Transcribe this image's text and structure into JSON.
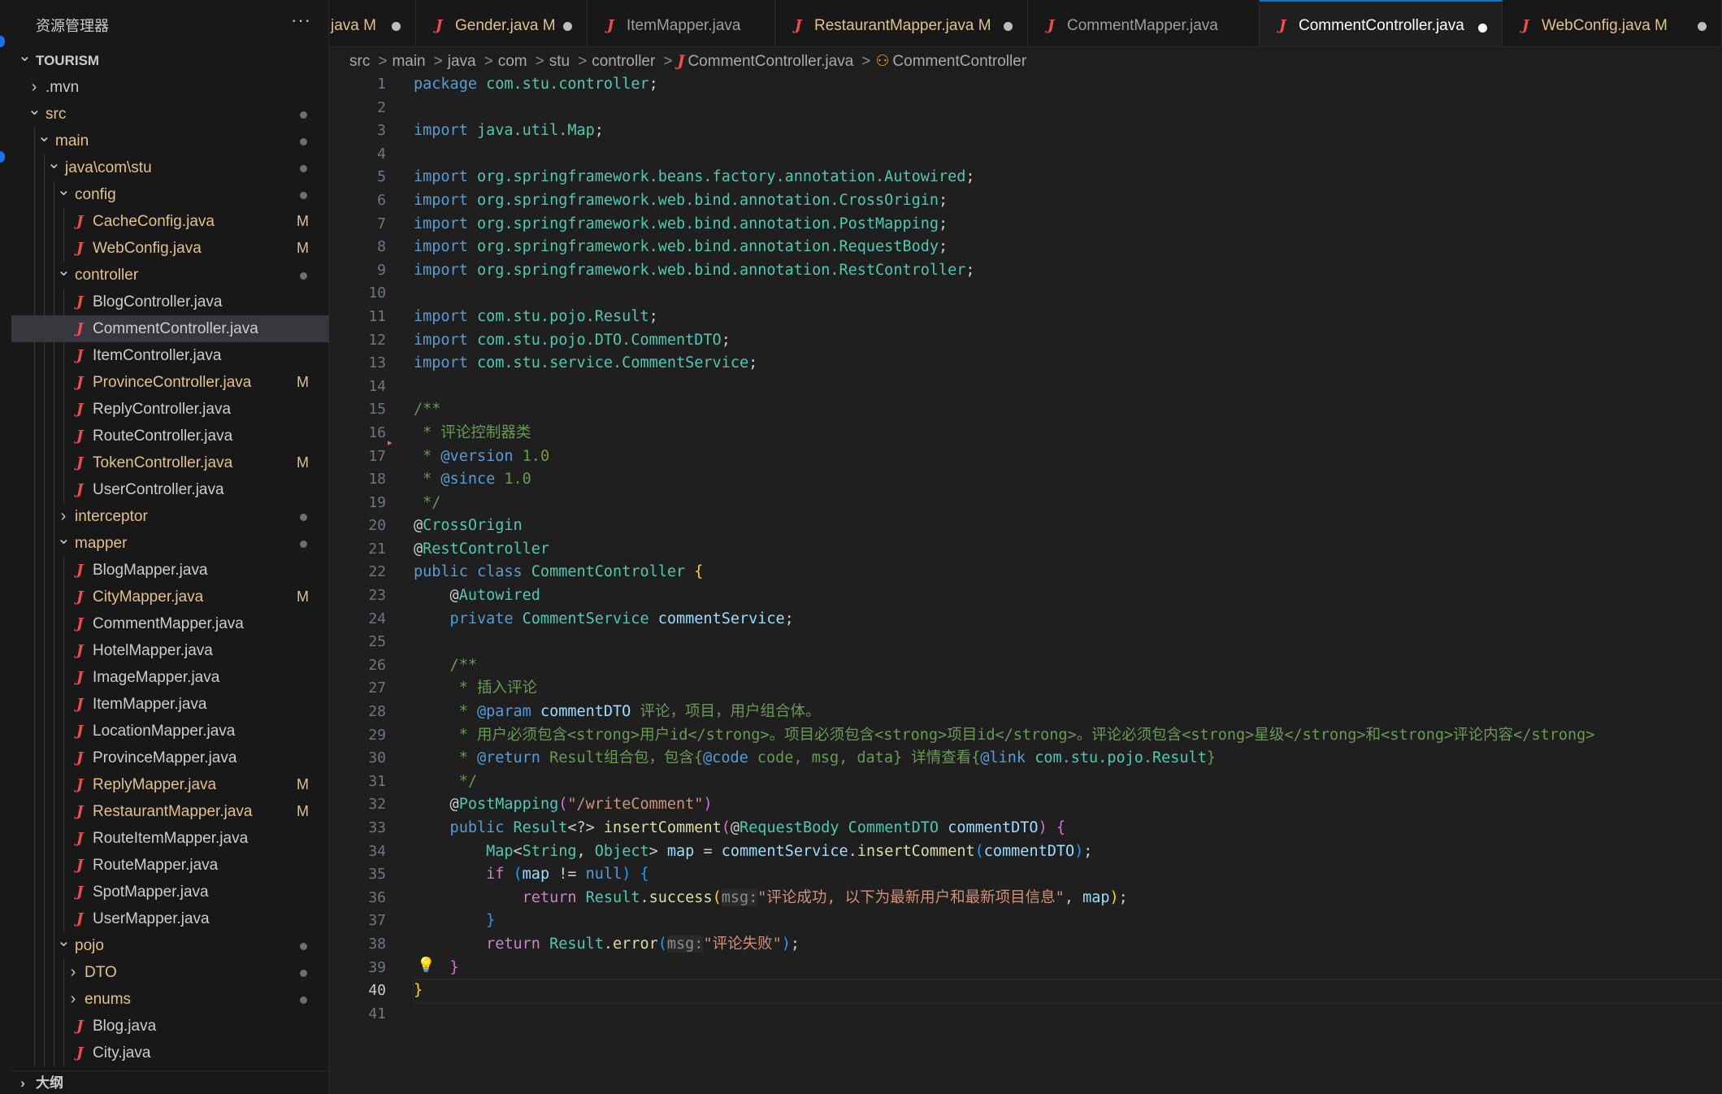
{
  "sidebar": {
    "title": "资源管理器",
    "more": "···",
    "outline_label": "大纲",
    "tree": [
      {
        "label": "TOURISM",
        "depth": 0,
        "kind": "root",
        "chevron": "open"
      },
      {
        "label": ".mvn",
        "depth": 1,
        "kind": "folder",
        "chevron": "closed"
      },
      {
        "label": "src",
        "depth": 1,
        "kind": "folder-mod",
        "chevron": "open",
        "dot": true
      },
      {
        "label": "main",
        "depth": 2,
        "kind": "folder-mod",
        "chevron": "open",
        "dot": true
      },
      {
        "label": "java\\com\\stu",
        "depth": 3,
        "kind": "folder-mod",
        "chevron": "open",
        "dot": true
      },
      {
        "label": "config",
        "depth": 4,
        "kind": "folder-mod",
        "chevron": "open",
        "dot": true
      },
      {
        "label": "CacheConfig.java",
        "depth": 5,
        "kind": "java-mod",
        "badge": "M"
      },
      {
        "label": "WebConfig.java",
        "depth": 5,
        "kind": "java-mod",
        "badge": "M"
      },
      {
        "label": "controller",
        "depth": 4,
        "kind": "folder-mod",
        "chevron": "open",
        "dot": true
      },
      {
        "label": "BlogController.java",
        "depth": 5,
        "kind": "java"
      },
      {
        "label": "CommentController.java",
        "depth": 5,
        "kind": "java",
        "selected": true
      },
      {
        "label": "ItemController.java",
        "depth": 5,
        "kind": "java"
      },
      {
        "label": "ProvinceController.java",
        "depth": 5,
        "kind": "java-mod",
        "badge": "M"
      },
      {
        "label": "ReplyController.java",
        "depth": 5,
        "kind": "java"
      },
      {
        "label": "RouteController.java",
        "depth": 5,
        "kind": "java"
      },
      {
        "label": "TokenController.java",
        "depth": 5,
        "kind": "java-mod",
        "badge": "M"
      },
      {
        "label": "UserController.java",
        "depth": 5,
        "kind": "java"
      },
      {
        "label": "interceptor",
        "depth": 4,
        "kind": "folder-mod",
        "chevron": "closed",
        "dot": true
      },
      {
        "label": "mapper",
        "depth": 4,
        "kind": "folder-mod",
        "chevron": "open",
        "dot": true
      },
      {
        "label": "BlogMapper.java",
        "depth": 5,
        "kind": "java"
      },
      {
        "label": "CityMapper.java",
        "depth": 5,
        "kind": "java-mod",
        "badge": "M"
      },
      {
        "label": "CommentMapper.java",
        "depth": 5,
        "kind": "java"
      },
      {
        "label": "HotelMapper.java",
        "depth": 5,
        "kind": "java"
      },
      {
        "label": "ImageMapper.java",
        "depth": 5,
        "kind": "java"
      },
      {
        "label": "ItemMapper.java",
        "depth": 5,
        "kind": "java"
      },
      {
        "label": "LocationMapper.java",
        "depth": 5,
        "kind": "java"
      },
      {
        "label": "ProvinceMapper.java",
        "depth": 5,
        "kind": "java"
      },
      {
        "label": "ReplyMapper.java",
        "depth": 5,
        "kind": "java-mod",
        "badge": "M"
      },
      {
        "label": "RestaurantMapper.java",
        "depth": 5,
        "kind": "java-mod",
        "badge": "M"
      },
      {
        "label": "RouteItemMapper.java",
        "depth": 5,
        "kind": "java"
      },
      {
        "label": "RouteMapper.java",
        "depth": 5,
        "kind": "java"
      },
      {
        "label": "SpotMapper.java",
        "depth": 5,
        "kind": "java"
      },
      {
        "label": "UserMapper.java",
        "depth": 5,
        "kind": "java"
      },
      {
        "label": "pojo",
        "depth": 4,
        "kind": "folder-mod",
        "chevron": "open",
        "dot": true
      },
      {
        "label": "DTO",
        "depth": 5,
        "kind": "folder-mod",
        "chevron": "closed",
        "dot": true
      },
      {
        "label": "enums",
        "depth": 5,
        "kind": "folder-mod",
        "chevron": "closed",
        "dot": true
      },
      {
        "label": "Blog.java",
        "depth": 5,
        "kind": "java"
      },
      {
        "label": "City.java",
        "depth": 5,
        "kind": "java"
      }
    ]
  },
  "tabs": [
    {
      "label": "java",
      "badge": "M",
      "modified": true,
      "dirty_dot": true,
      "icon": false
    },
    {
      "label": "Gender.java",
      "badge": "M",
      "modified": true,
      "dirty_dot": true,
      "icon": true
    },
    {
      "label": "ItemMapper.java",
      "modified": false,
      "icon": true
    },
    {
      "label": "RestaurantMapper.java",
      "badge": "M",
      "modified": true,
      "dirty_dot": true,
      "icon": true
    },
    {
      "label": "CommentMapper.java",
      "modified": false,
      "icon": true
    },
    {
      "label": "CommentController.java",
      "modified": false,
      "dirty_dot": true,
      "icon": true,
      "active": true
    },
    {
      "label": "WebConfig.java",
      "badge": "M",
      "modified": true,
      "dirty_dot": true,
      "icon": true
    }
  ],
  "breadcrumb": {
    "parts": [
      "src",
      "main",
      "java",
      "com",
      "stu",
      "controller"
    ],
    "file": "CommentController.java",
    "symbol": "CommentController",
    "separator": ">",
    "java_glyph": "J",
    "class_glyph": "⚇"
  },
  "editor": {
    "current_line": 40,
    "lines": [
      [
        [
          "kw",
          "package "
        ],
        [
          "pkg",
          "com.stu.controller"
        ],
        [
          "plain",
          ";"
        ]
      ],
      [],
      [
        [
          "kw",
          "import "
        ],
        [
          "pkg",
          "java.util.Map"
        ],
        [
          "plain",
          ";"
        ]
      ],
      [],
      [
        [
          "kw",
          "import "
        ],
        [
          "pkg",
          "org.springframework.beans.factory.annotation.Autowired"
        ],
        [
          "plain",
          ";"
        ]
      ],
      [
        [
          "kw",
          "import "
        ],
        [
          "pkg",
          "org.springframework.web.bind.annotation.CrossOrigin"
        ],
        [
          "plain",
          ";"
        ]
      ],
      [
        [
          "kw",
          "import "
        ],
        [
          "pkg",
          "org.springframework.web.bind.annotation.PostMapping"
        ],
        [
          "plain",
          ";"
        ]
      ],
      [
        [
          "kw",
          "import "
        ],
        [
          "pkg",
          "org.springframework.web.bind.annotation.RequestBody"
        ],
        [
          "plain",
          ";"
        ]
      ],
      [
        [
          "kw",
          "import "
        ],
        [
          "pkg",
          "org.springframework.web.bind.annotation.RestController"
        ],
        [
          "plain",
          ";"
        ]
      ],
      [],
      [
        [
          "kw",
          "import "
        ],
        [
          "pkg",
          "com.stu.pojo.Result"
        ],
        [
          "plain",
          ";"
        ]
      ],
      [
        [
          "kw",
          "import "
        ],
        [
          "pkg",
          "com.stu.pojo.DTO.CommentDTO"
        ],
        [
          "plain",
          ";"
        ]
      ],
      [
        [
          "kw",
          "import "
        ],
        [
          "pkg",
          "com.stu.service.CommentService"
        ],
        [
          "plain",
          ";"
        ]
      ],
      [],
      [
        [
          "cm",
          "/**"
        ]
      ],
      [
        [
          "cm",
          " * 评论控制器类"
        ]
      ],
      [
        [
          "cm",
          " * "
        ],
        [
          "cmt",
          "@version"
        ],
        [
          "cm",
          " 1.0"
        ]
      ],
      [
        [
          "cm",
          " * "
        ],
        [
          "cmt",
          "@since"
        ],
        [
          "cm",
          " 1.0"
        ]
      ],
      [
        [
          "cm",
          " */"
        ]
      ],
      [
        [
          "plain",
          "@"
        ],
        [
          "an",
          "CrossOrigin"
        ]
      ],
      [
        [
          "plain",
          "@"
        ],
        [
          "an",
          "RestController"
        ]
      ],
      [
        [
          "kw",
          "public class "
        ],
        [
          "ty",
          "CommentController "
        ],
        [
          "br1",
          "{"
        ]
      ],
      [
        [
          "plain",
          "    @"
        ],
        [
          "an",
          "Autowired"
        ]
      ],
      [
        [
          "kw",
          "    private "
        ],
        [
          "ty",
          "CommentService "
        ],
        [
          "id",
          "commentService"
        ],
        [
          "plain",
          ";"
        ]
      ],
      [],
      [
        [
          "cm",
          "    /**"
        ]
      ],
      [
        [
          "cm",
          "     * 插入评论"
        ]
      ],
      [
        [
          "cm",
          "     * "
        ],
        [
          "cmt",
          "@param "
        ],
        [
          "id",
          "commentDTO"
        ],
        [
          "cm",
          " 评论，项目，用户组合体。"
        ]
      ],
      [
        [
          "cm",
          "     * 用户必须包含<strong>用户id</strong>。项目必须包含<strong>项目id</strong>。评论必须包含<strong>星级</strong>和<strong>评论内容</strong>"
        ]
      ],
      [
        [
          "cm",
          "     * "
        ],
        [
          "cmt",
          "@return"
        ],
        [
          "cm",
          " Result组合包，包含{"
        ],
        [
          "cmt",
          "@code"
        ],
        [
          "cm",
          " code, msg, data} 详情查看{"
        ],
        [
          "cmt",
          "@link"
        ],
        [
          "ref",
          " com.stu.pojo.Result"
        ],
        [
          "cm",
          "}"
        ]
      ],
      [
        [
          "cm",
          "     */"
        ]
      ],
      [
        [
          "plain",
          "    @"
        ],
        [
          "an",
          "PostMapping"
        ],
        [
          "br2",
          "("
        ],
        [
          "str",
          "\"/writeComment\""
        ],
        [
          "br2",
          ")"
        ]
      ],
      [
        [
          "kw",
          "    public "
        ],
        [
          "ty",
          "Result"
        ],
        [
          "plain",
          "<?> "
        ],
        [
          "fn",
          "insertComment"
        ],
        [
          "br2",
          "("
        ],
        [
          "plain",
          "@"
        ],
        [
          "an",
          "RequestBody "
        ],
        [
          "ty",
          "CommentDTO "
        ],
        [
          "id",
          "commentDTO"
        ],
        [
          "br2",
          ")"
        ],
        [
          "plain",
          " "
        ],
        [
          "br2",
          "{"
        ]
      ],
      [
        [
          "ty",
          "        Map"
        ],
        [
          "plain",
          "<"
        ],
        [
          "ty",
          "String"
        ],
        [
          "plain",
          ", "
        ],
        [
          "ty",
          "Object"
        ],
        [
          "plain",
          "> "
        ],
        [
          "id",
          "map"
        ],
        [
          "plain",
          " = "
        ],
        [
          "id",
          "commentService"
        ],
        [
          "plain",
          "."
        ],
        [
          "fn",
          "insertComment"
        ],
        [
          "br3",
          "("
        ],
        [
          "id",
          "commentDTO"
        ],
        [
          "br3",
          ")"
        ],
        [
          "plain",
          ";"
        ]
      ],
      [
        [
          "kwc",
          "        if "
        ],
        [
          "br3",
          "("
        ],
        [
          "id",
          "map"
        ],
        [
          "plain",
          " != "
        ],
        [
          "kw",
          "null"
        ],
        [
          "br3",
          ")"
        ],
        [
          "plain",
          " "
        ],
        [
          "br3",
          "{"
        ]
      ],
      [
        [
          "kwc",
          "            return "
        ],
        [
          "ty",
          "Result"
        ],
        [
          "plain",
          "."
        ],
        [
          "fn",
          "success"
        ],
        [
          "br1",
          "("
        ],
        [
          "hint",
          "msg:"
        ],
        [
          "str",
          "\"评论成功, 以下为最新用户和最新项目信息\""
        ],
        [
          "plain",
          ", "
        ],
        [
          "id",
          "map"
        ],
        [
          "br1",
          ")"
        ],
        [
          "plain",
          ";"
        ]
      ],
      [
        [
          "br3",
          "        }"
        ]
      ],
      [
        [
          "kwc",
          "        return "
        ],
        [
          "ty",
          "Result"
        ],
        [
          "plain",
          "."
        ],
        [
          "fn",
          "error"
        ],
        [
          "br3",
          "("
        ],
        [
          "hint",
          "msg:"
        ],
        [
          "str",
          "\"评论失败\""
        ],
        [
          "br3",
          ")"
        ],
        [
          "plain",
          ";"
        ]
      ],
      [
        [
          "br2",
          "    }"
        ]
      ],
      [
        [
          "br1",
          "}"
        ]
      ],
      []
    ]
  },
  "icons": {
    "java": "J",
    "chevron_open": "⌄",
    "chevron_closed": "›",
    "outline_chevron": "›",
    "bulb": "💡",
    "fold": "▸"
  },
  "colors": {
    "accent": "#0078d4",
    "modified": "#e2c08d",
    "java_icon": "#f14c4c"
  }
}
